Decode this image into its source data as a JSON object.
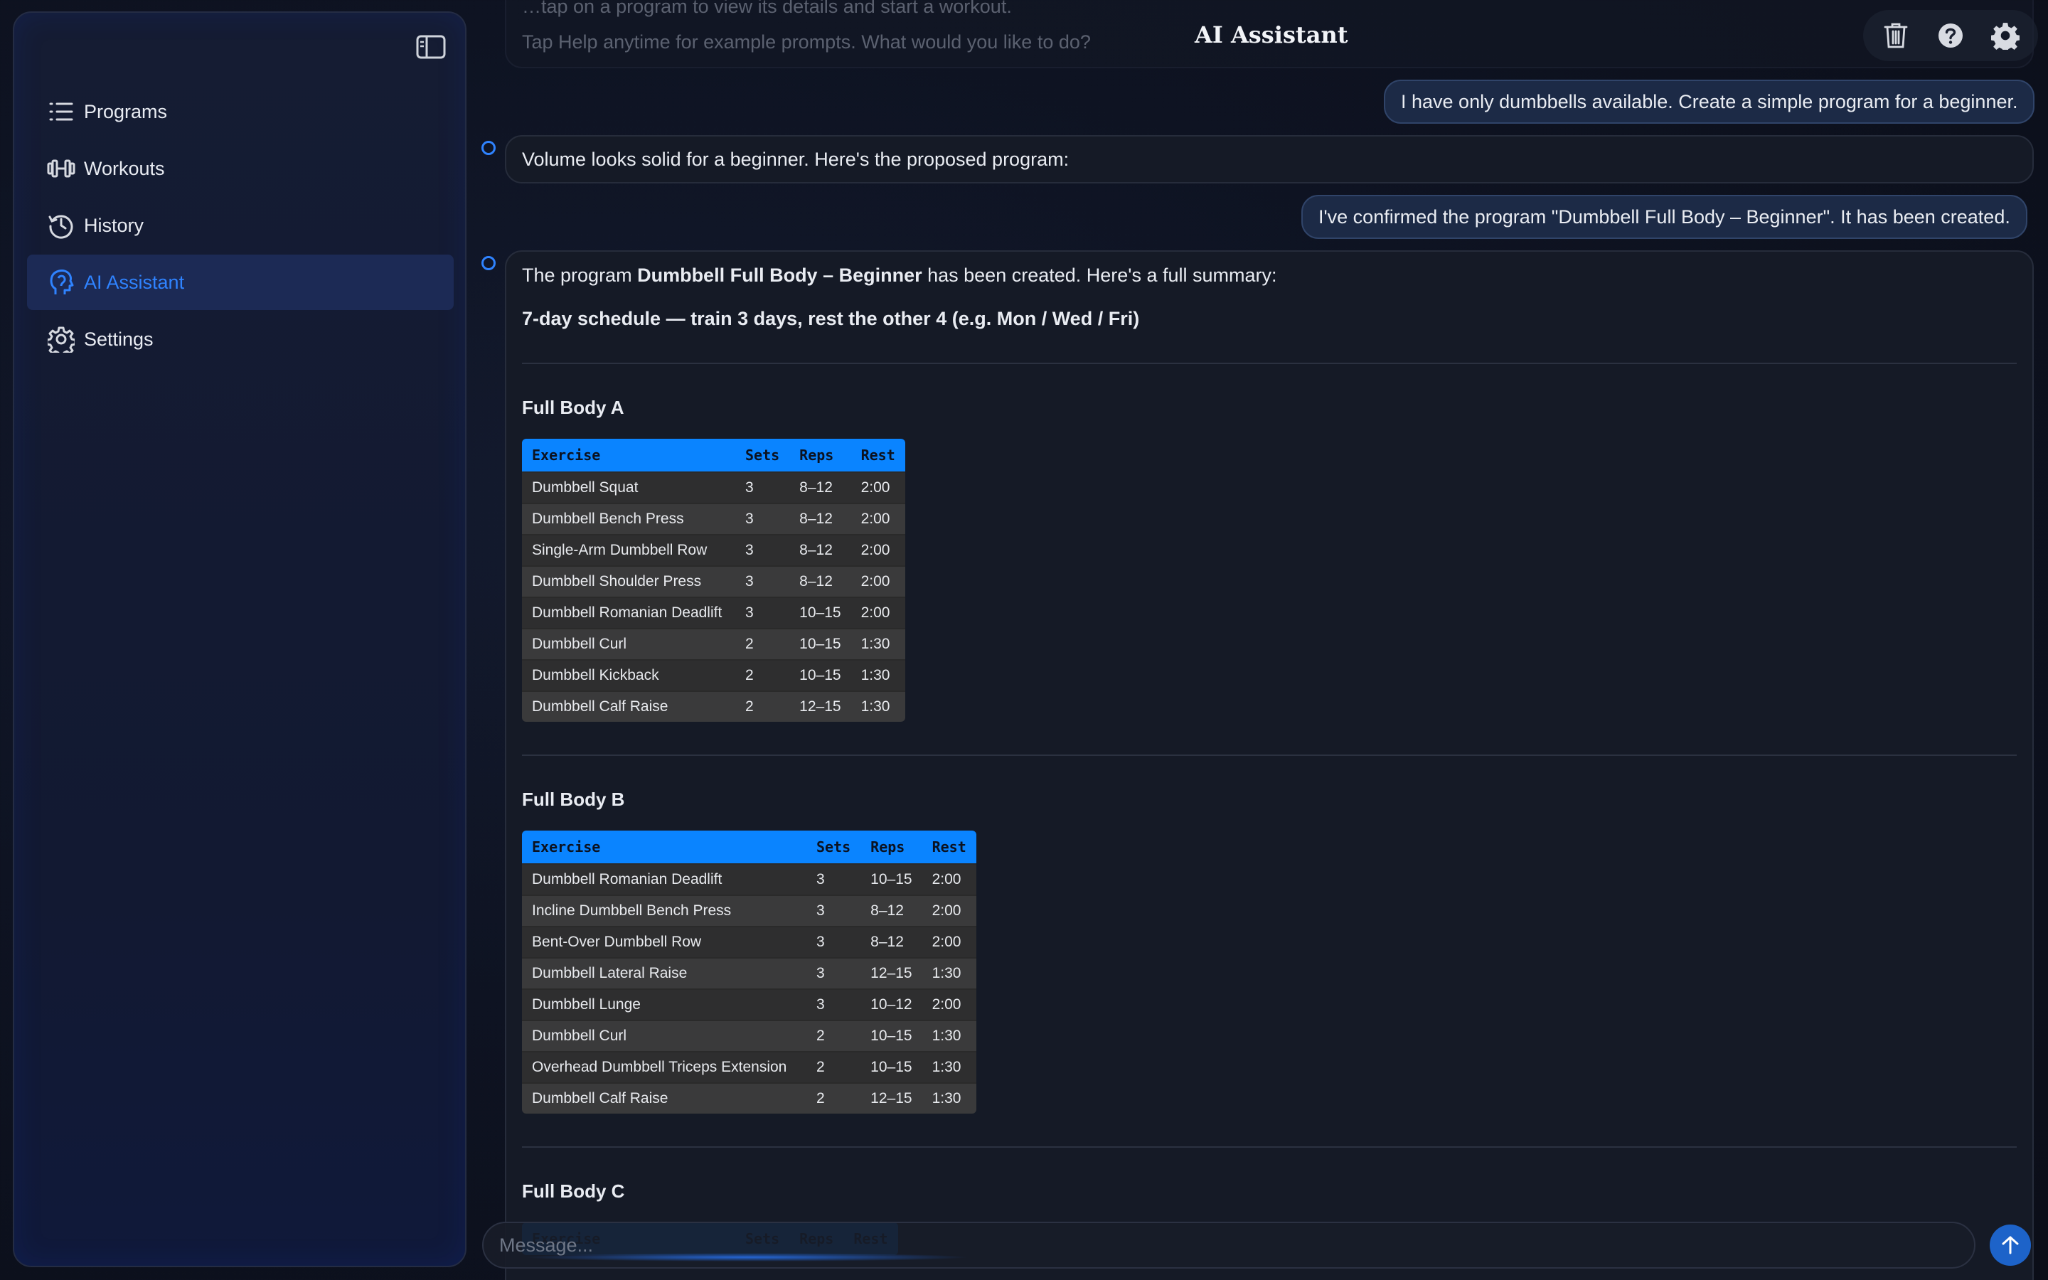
{
  "app": {
    "title": "AI Assistant"
  },
  "sidebar": {
    "items": [
      {
        "label": "Programs",
        "icon": "list-icon",
        "active": false
      },
      {
        "label": "Workouts",
        "icon": "dumbbell-icon",
        "active": false
      },
      {
        "label": "History",
        "icon": "history-icon",
        "active": false
      },
      {
        "label": "AI Assistant",
        "icon": "ai-head-icon",
        "active": true
      },
      {
        "label": "Settings",
        "icon": "gear-icon",
        "active": false
      }
    ]
  },
  "colors": {
    "accent": "#2f83ff",
    "table_header": "#0a84ff",
    "active_nav_bg": "#1c2a55"
  },
  "chat": {
    "faded_lines": [
      "…tap on a program to view its details and start a workout.",
      "Tap Help anytime for example prompts. What would you like to do?"
    ],
    "user_msg_1": "I have only dumbbells available. Create a simple program for a beginner.",
    "ai_msg_1": "Volume looks solid for a beginner. Here's the proposed program:",
    "user_msg_2": "I've confirmed the program \"Dumbbell Full Body – Beginner\". It has been created.",
    "summary": {
      "prefix": "The program ",
      "program_name": "Dumbbell Full Body – Beginner",
      "suffix": " has been created. Here's a full summary:",
      "schedule": "7-day schedule — train 3 days, rest the other 4 (e.g. Mon / Wed / Fri)",
      "headers": [
        "Exercise",
        "Sets",
        "Reps",
        "Rest"
      ],
      "days": [
        {
          "title": "Full Body A",
          "rows": [
            [
              "Dumbbell Squat",
              "3",
              "8–12",
              "2:00"
            ],
            [
              "Dumbbell Bench Press",
              "3",
              "8–12",
              "2:00"
            ],
            [
              "Single-Arm Dumbbell Row",
              "3",
              "8–12",
              "2:00"
            ],
            [
              "Dumbbell Shoulder Press",
              "3",
              "8–12",
              "2:00"
            ],
            [
              "Dumbbell Romanian Deadlift",
              "3",
              "10–15",
              "2:00"
            ],
            [
              "Dumbbell Curl",
              "2",
              "10–15",
              "1:30"
            ],
            [
              "Dumbbell Kickback",
              "2",
              "10–15",
              "1:30"
            ],
            [
              "Dumbbell Calf Raise",
              "2",
              "12–15",
              "1:30"
            ]
          ]
        },
        {
          "title": "Full Body B",
          "rows": [
            [
              "Dumbbell Romanian Deadlift",
              "3",
              "10–15",
              "2:00"
            ],
            [
              "Incline Dumbbell Bench Press",
              "3",
              "8–12",
              "2:00"
            ],
            [
              "Bent-Over Dumbbell Row",
              "3",
              "8–12",
              "2:00"
            ],
            [
              "Dumbbell Lateral Raise",
              "3",
              "12–15",
              "1:30"
            ],
            [
              "Dumbbell Lunge",
              "3",
              "10–12",
              "2:00"
            ],
            [
              "Dumbbell Curl",
              "2",
              "10–15",
              "1:30"
            ],
            [
              "Overhead Dumbbell Triceps Extension",
              "2",
              "10–15",
              "1:30"
            ],
            [
              "Dumbbell Calf Raise",
              "2",
              "12–15",
              "1:30"
            ]
          ]
        },
        {
          "title": "Full Body C",
          "rows": []
        }
      ]
    }
  },
  "composer": {
    "placeholder": "Message..."
  }
}
